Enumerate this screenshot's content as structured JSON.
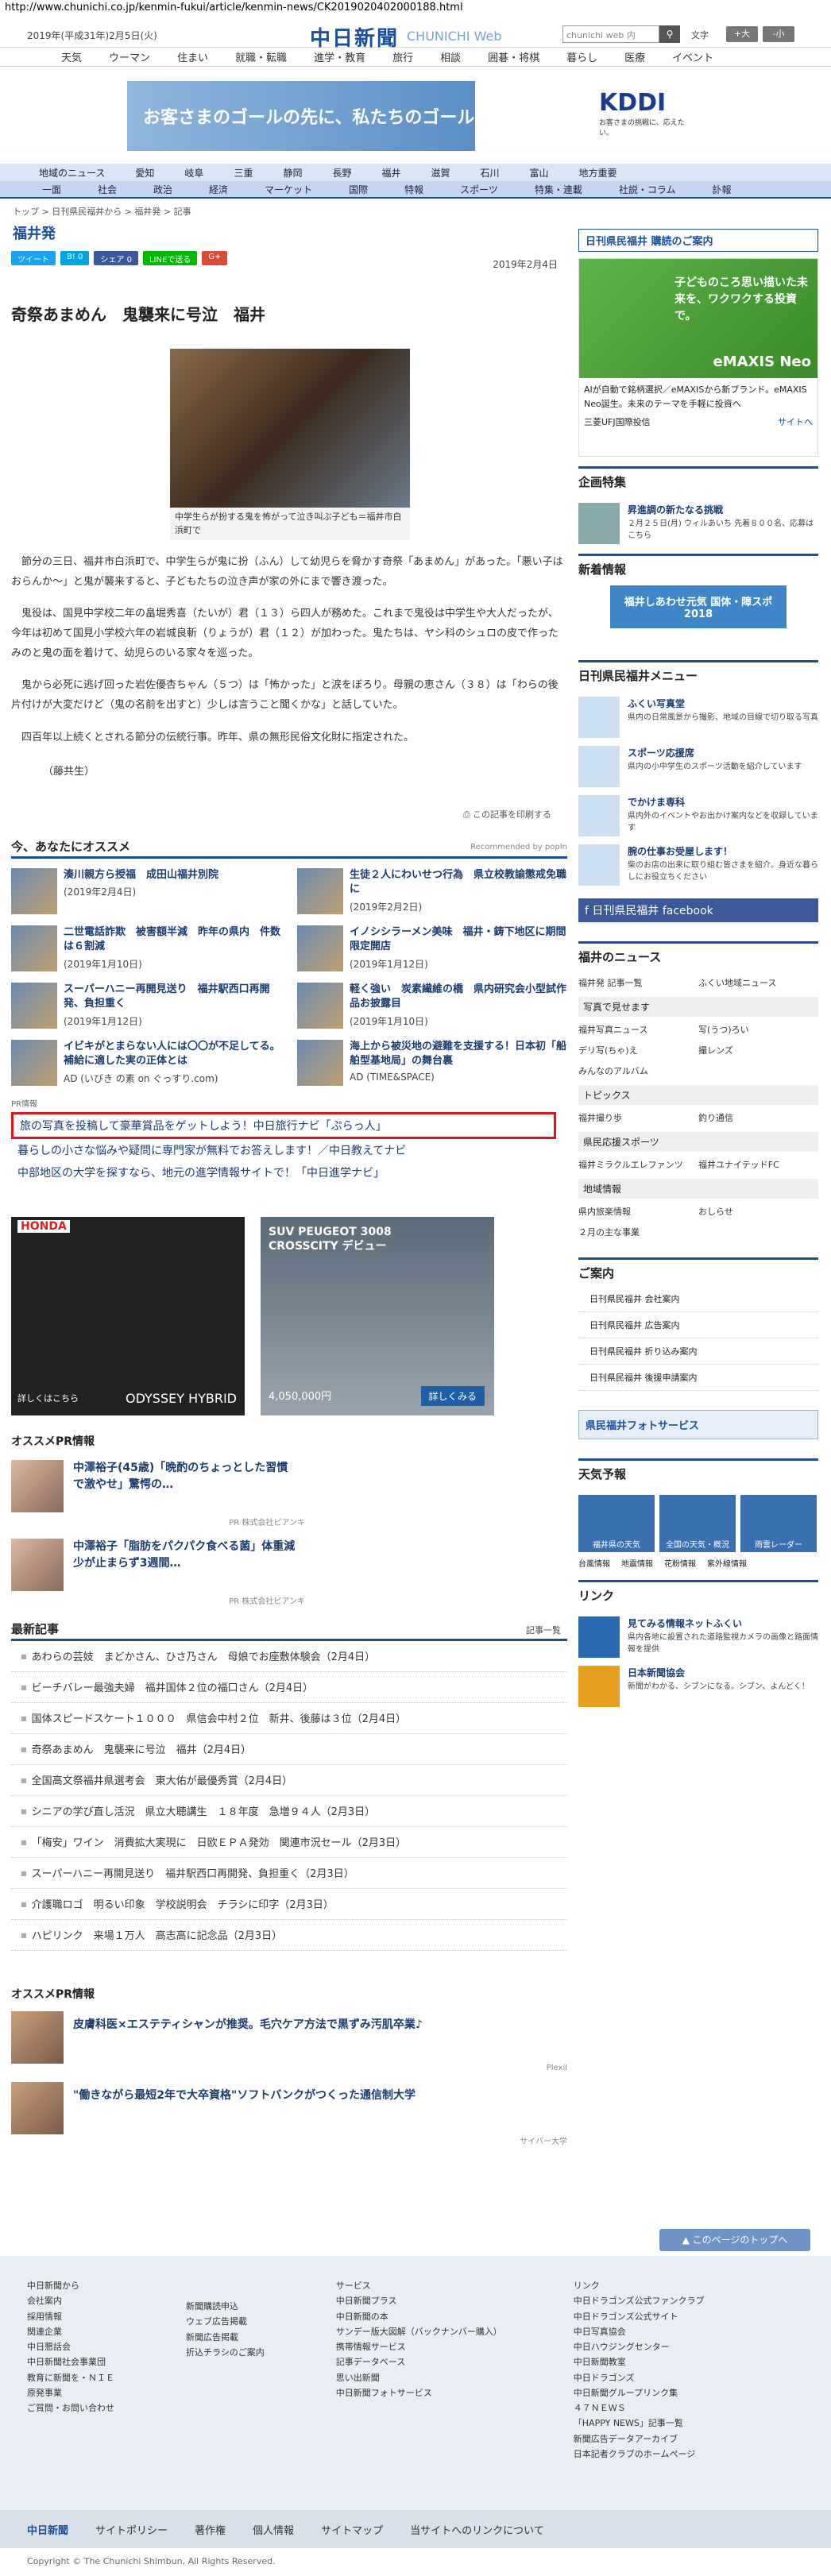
{
  "url": "http://www.chunichi.co.jp/kenmin-fukui/article/kenmin-news/CK2019020402000188.html",
  "header": {
    "date": "2019年(平成31年)2月5日(火)",
    "logo": "中日新聞",
    "logo_sub": "CHUNICHI Web",
    "search_placeholder": "chunichi web 内",
    "search_button": "検索",
    "font_size_label": "文字",
    "font_large": "+大",
    "font_small": "-小"
  },
  "global_nav": [
    "天気",
    "ウーマン",
    "住まい",
    "就職・転職",
    "進学・教育",
    "旅行",
    "相談",
    "囲碁・将棋",
    "暮らし",
    "医療",
    "イベント"
  ],
  "banner": {
    "text": "お客さまのゴールの先に、私たちのゴールはある。",
    "brand": "KDDI",
    "brand_sub": "お客さまの挑戦に、応えたい。"
  },
  "regional_nav": [
    "地域のニュース",
    "愛知",
    "岐阜",
    "三重",
    "静岡",
    "長野",
    "福井",
    "滋賀",
    "石川",
    "富山",
    "地方重要"
  ],
  "category_nav": [
    "一面",
    "社会",
    "政治",
    "経済",
    "マーケット",
    "国際",
    "特報",
    "スポーツ",
    "特集・連載",
    "社説・コラム",
    "訃報"
  ],
  "breadcrumb": "トップ > 日刊県民福井から > 福井発 > 記事",
  "section_title": "福井発",
  "share_buttons": [
    "ツイート",
    "B! 0",
    "シェア 0",
    "LINEで送る",
    "G+"
  ],
  "article": {
    "date": "2019年2月4日",
    "headline": "奇祭あまめん　鬼襲来に号泣　福井",
    "photo_caption": "中学生らが扮する鬼を怖がって泣き叫ぶ子ども＝福井市白浜町で",
    "paragraphs": [
      "節分の三日、福井市白浜町で、中学生らが鬼に扮（ふん）して幼児らを脅かす奇祭「あまめん」があった。「悪い子はおらんか～」と鬼が襲来すると、子どもたちの泣き声が家の外にまで響き渡った。",
      "鬼役は、国見中学校二年の畠堀秀喜（たいが）君（１３）ら四人が務めた。これまで鬼役は中学生や大人だったが、今年は初めて国見小学校六年の岩城良斬（りょうが）君（１２）が加わった。鬼たちは、ヤシ科のシュロの皮で作ったみのと鬼の面を着けて、幼児らのいる家々を巡った。",
      "鬼から必死に逃げ回った岩佐優杏ちゃん（５つ）は「怖かった」と涙をぼろり。母親の恵さん（３８）は「わらの後片付けが大変だけど（鬼の名前を出すと）少しは言うこと聞くかな」と話していた。",
      "四百年以上続くとされる節分の伝統行事。昨年、県の無形民俗文化財に指定された。"
    ],
    "author": "（藤共生）",
    "print_label": "この記事を印刷する"
  },
  "recommend": {
    "title": "今、あなたにオススメ",
    "by": "Recommended by popIn",
    "items": [
      {
        "title": "湊川親方ら授福　成田山福井別院",
        "date": "(2019年2月4日)"
      },
      {
        "title": "生徒２人にわいせつ行為　県立校教諭懲戒免職に",
        "date": "(2019年2月2日)"
      },
      {
        "title": "二世電話詐欺　被害額半減　昨年の県内　件数は６割減",
        "date": "(2019年1月10日)"
      },
      {
        "title": "イノシシラーメン美味　福井・鋳下地区に期間限定開店",
        "date": "(2019年1月12日)"
      },
      {
        "title": "スーパーハニー再開見送り　福井駅西口再開発、負担重く",
        "date": "(2019年1月12日)"
      },
      {
        "title": "軽く強い　炭素繊維の橋　県内研究会小型試作品お披露目",
        "date": "(2019年1月10日)"
      },
      {
        "title": "イビキがとまらない人には〇〇が不足してる。補給に適した実の正体とは",
        "date": "AD (いびき の素 on ぐっすり.com)"
      },
      {
        "title": "海上から被災地の避難を支援する！日本初「船舶型基地局」の舞台裏",
        "date": "AD (TIME&SPACE)"
      }
    ]
  },
  "pr": {
    "label": "PR情報",
    "items": [
      "旅の写真を投稿して豪華賞品をゲットしよう！中日旅行ナビ「ぷらっ人」",
      "暮らしの小さな悩みや疑問に専門家が無料でお答えします！／中日教えてナビ",
      "中部地区の大学を探すなら、地元の進学情報サイトで！「中日進学ナビ」"
    ]
  },
  "ads": [
    {
      "brand": "HONDA",
      "model": "ODYSSEY HYBRID",
      "cta": "詳しくはこちら"
    },
    {
      "brand": "SUV PEUGEOT 3008 CROSSCITY デビュー",
      "price": "4,050,000円",
      "cta": "詳しくみる"
    }
  ],
  "osusume_pr": {
    "title": "オススメPR情報",
    "items": [
      {
        "text": "中澤裕子(45歳)「晩酌のちょっとした習慣で激やせ」驚愕の…",
        "src": "PR  株式会社ピアンキ"
      },
      {
        "text": "中澤裕子「脂肪をパクパク食べる菌」体重減少が止まらず3週間…",
        "src": "PR  株式会社ピアンキ"
      }
    ]
  },
  "latest": {
    "title": "最新記事",
    "more": "記事一覧",
    "items": [
      "あわらの芸妓　まどかさん、ひさ乃さん　母娘でお座敷体験会（2月4日）",
      "ビーチバレー最強夫婦　福井国体２位の福口さん（2月4日）",
      "国体スピードスケート１０００　県信会中村２位　新井、後藤は３位（2月4日）",
      "奇祭あまめん　鬼襲来に号泣　福井（2月4日）",
      "全国高文祭福井県選考会　東大佑が最優秀賞（2月4日）",
      "シニアの学び直し活況　県立大聴講生　１８年度　急増９４人（2月3日）",
      "「梅安」ワイン　消費拡大実現に　日欧ＥＰＡ発効　関連市況セール（2月3日）",
      "スーパーハニー再開見送り　福井駅西口再開発、負担重く（2月3日）",
      "介護職ロゴ　明るい印象　学校説明会　チラシに印字（2月3日）",
      "ハピリンク　来場１万人　高志高に記念品（2月3日）"
    ]
  },
  "osusume_pr2": {
    "title": "オススメPR情報",
    "items": [
      {
        "text": "皮膚科医×エステティシャンが推奨。毛穴ケア方法で黒ずみ汚肌卒業♪",
        "src": "Plexil"
      },
      {
        "text": "\"働きながら最短2年で大卒資格\"ソフトバンクがつくった通信制大学",
        "src": "サイバー大学"
      }
    ]
  },
  "side": {
    "ad_label": "日刊県民福井 購読のご案内",
    "ad_copy": "子どものころ思い描いた未来を、ワクワクする投資で。",
    "ad_brand": "eMAXIS Neo",
    "ad_text": "AIが自動で銘柄選択／eMAXISから新ブランド。eMAXIS Neo誕生。未来のテーマを手軽に投資へ",
    "ad_sponsor": "三菱UFJ国際投信",
    "ad_site": "サイトへ",
    "kikaku_title": "企画特集",
    "kikaku_item": "昇進調の新たなる挑戦",
    "kikaku_desc": "２月２５日(月) ウィルあいち 先着８００名、応募はこちら",
    "shinsaku_title": "新着情報",
    "shinsaku_banner": "福井しあわせ元気 国体・障スポ 2018",
    "menu_title": "日刊県民福井メニュー",
    "menu_items": [
      {
        "t": "ふくい写真堂",
        "d": "県内の日常風景から撮影、地域の目線で切り取る写真"
      },
      {
        "t": "スポーツ応援席",
        "d": "県内の小中学生のスポーツ活動を紹介しています"
      },
      {
        "t": "でかけま専科",
        "d": "県内外のイベントやお出かけ案内などを収録しています"
      },
      {
        "t": "腕の仕事お受屋します！",
        "d": "柴のお店の出来に取り組む皆さまを紹介。身近な暮らしにお役立ちください"
      }
    ],
    "facebook": "日刊県民福井 facebook",
    "fukui_news_title": "福井のニュース",
    "fukui_news": [
      "福井発 記事一覧",
      "ふくい地域ニュース"
    ],
    "sections": [
      {
        "h": "写真で見せます",
        "items": [
          "福井写真ニュース",
          "写(うつ)ろい",
          "デリ写(ちゃ)え",
          "撮レンズ",
          "みんなのアルバム"
        ]
      },
      {
        "h": "トピックス",
        "items": [
          "福井撮り歩",
          "釣り通信"
        ]
      },
      {
        "h": "県民応援スポーツ",
        "items": [
          "福井ミラクルエレファンツ",
          "福井ユナイテッドFC"
        ]
      },
      {
        "h": "地域情報",
        "items": [
          "県内旅楽情報",
          "おしらせ",
          "２月の主な事業"
        ]
      }
    ],
    "annai_title": "ご案内",
    "annai": [
      "日刊県民福井 会社案内",
      "日刊県民福井 広告案内",
      "日刊県民福井 折り込み案内",
      "日刊県民福井 後援申請案内"
    ],
    "fukui_foto": "県民福井フォトサービス",
    "weather_title": "天気予報",
    "weather": [
      "福井県の天気",
      "全国の天気・概況",
      "雨雲レーダー"
    ],
    "weather_links": [
      "台風情報",
      "地震情報",
      "花粉情報",
      "紫外線情報"
    ],
    "link_title": "リンク",
    "link_items": [
      {
        "t": "見てみる情報ネットふくい",
        "d": "県内各地に設置された道路監視カメラの画像と路面情報を提供"
      },
      {
        "t": "日本新聞協会",
        "d": "新聞がわかる、シブンになる。シブン、よんどく！"
      }
    ]
  },
  "pagetop": "このページのトップへ",
  "footer": {
    "cols": [
      [
        "中日新聞から",
        "会社案内",
        "採用情報",
        "関連企業",
        "中日懇話会",
        "中日新聞社会事業団",
        "教育に新聞を・ＮＩＥ",
        "原発事業",
        "ご質問・お問い合わせ"
      ],
      [
        "新聞購読申込",
        "ウェブ広告掲載",
        "新聞広告掲載",
        "折込チラシのご案内"
      ],
      [
        "サービス",
        "中日新聞プラス",
        "中日新聞の本",
        "サンデー版大図解（バックナンバー購入）",
        "携帯情報サービス",
        "記事データベース",
        "思い出新聞",
        "中日新聞フォトサービス"
      ],
      [
        "リンク",
        "中日ドラゴンズ公式ファンクラブ",
        "中日ドラゴンズ公式サイト",
        "中日写真協会",
        "中日ハウジングセンター",
        "中日新聞教室",
        "中日ドラゴンズ",
        "中日新聞グループリンク集",
        "４７ＮＥＷＳ",
        "「HAPPY NEWS」記事一覧",
        "新聞広告データアーカイブ",
        "日本記者クラブのホームページ"
      ]
    ],
    "bar": [
      "中日新聞",
      "サイトポリシー",
      "著作権",
      "個人情報",
      "サイトマップ",
      "当サイトへのリンクについて"
    ],
    "copyright": "Copyright © The Chunichi Shimbun, All Rights Reserved."
  }
}
